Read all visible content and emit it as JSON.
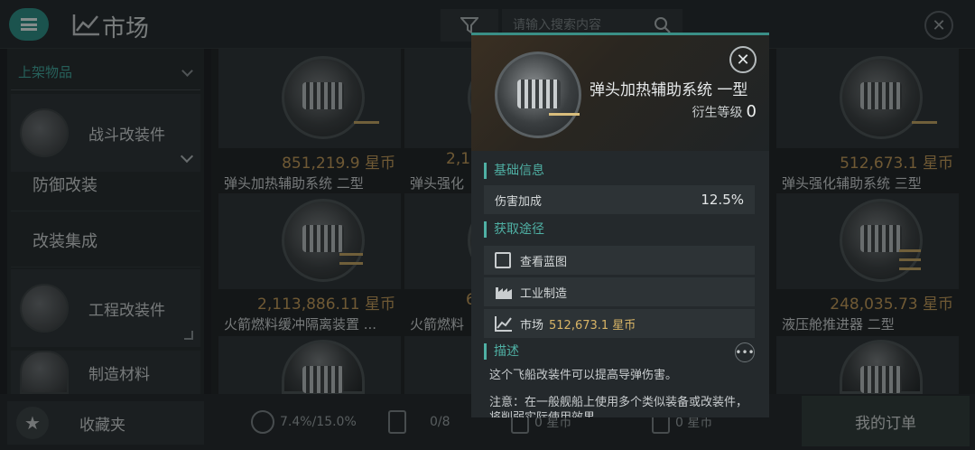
{
  "header": {
    "title": "市场",
    "search_placeholder": "请输入搜索内容"
  },
  "sidebar": {
    "dropdown_label": "上架物品",
    "categories": [
      {
        "label": "战斗改装件"
      },
      {
        "label": "工程改装件"
      },
      {
        "label": "制造材料"
      }
    ],
    "subitems": [
      {
        "label": "防御改装"
      },
      {
        "label": "改装集成"
      }
    ],
    "favorites_label": "收藏夹"
  },
  "grid": {
    "items": [
      {
        "price": "851,219.9 星币",
        "name": "弹头加热辅助系统 二型"
      },
      {
        "price": "2,1",
        "name": "弹头强化"
      },
      {
        "price": "512,673.1 星币",
        "name": "弹头强化辅助系统 三型"
      },
      {
        "price": "2,113,886.11 星币",
        "name": "火箭燃料缓冲隔离装置 ..."
      },
      {
        "price": "6",
        "name": "火箭燃料"
      },
      {
        "price": "248,035.73 星币",
        "name": "液压舱推进器 二型"
      }
    ]
  },
  "bottom": {
    "tax": "7.4%/15.0%",
    "orders_count": "0/8",
    "value1": "0 星币",
    "value2": "0 星币",
    "orders_button": "我的订单"
  },
  "popup": {
    "title": "弹头加热辅助系统 一型",
    "level_label": "衍生等级",
    "level_value": "0",
    "basic_section": "基础信息",
    "damage_label": "伤害加成",
    "damage_value": "12.5%",
    "source_section": "获取途径",
    "blueprint_label": "查看蓝图",
    "industry_label": "工业制造",
    "market_label": "市场",
    "market_price": "512,673.1 星币",
    "desc_section": "描述",
    "desc_text": "这个飞船改装件可以提高导弹伤害。",
    "note_text": "注意：在一般舰船上使用多个类似装备或改装件，将削弱实际使用效果。"
  },
  "colors": {
    "accent": "#2a8f86",
    "price": "#c49a57",
    "section": "#4fb0a4"
  }
}
